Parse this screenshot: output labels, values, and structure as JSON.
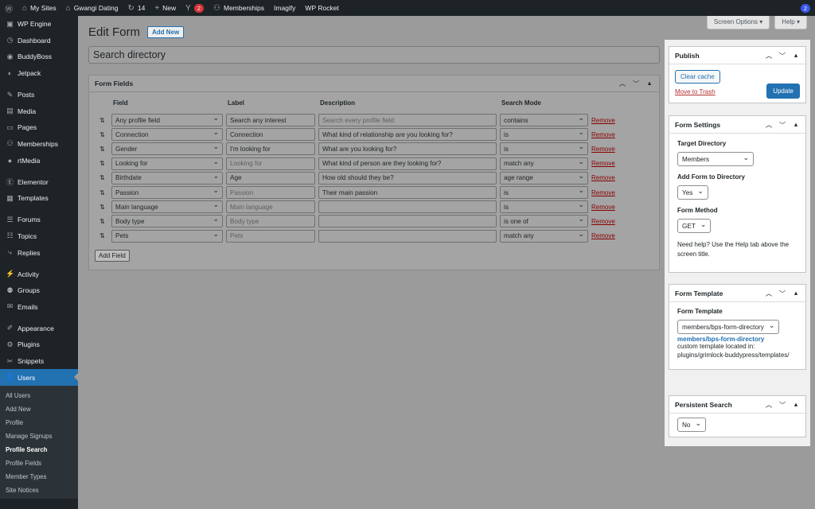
{
  "adminbar": {
    "my_sites": "My Sites",
    "site_name": "Gwangi Dating",
    "updates_count": "14",
    "new_label": "New",
    "yoast_badge": "2",
    "memberships": "Memberships",
    "imagify": "Imagify",
    "wp_rocket": "WP Rocket",
    "right_badge": "2"
  },
  "sidebar": {
    "items": [
      {
        "label": "WP Engine",
        "icon": "wp-engine-icon"
      },
      {
        "label": "Dashboard",
        "icon": "dashboard-icon"
      },
      {
        "label": "BuddyBoss",
        "icon": "buddyboss-icon"
      },
      {
        "label": "Jetpack",
        "icon": "jetpack-icon"
      },
      {
        "label": "Posts",
        "icon": "pin-icon"
      },
      {
        "label": "Media",
        "icon": "media-icon"
      },
      {
        "label": "Pages",
        "icon": "pages-icon"
      },
      {
        "label": "Memberships",
        "icon": "memberships-icon"
      },
      {
        "label": "rtMedia",
        "icon": "rtmedia-icon"
      },
      {
        "label": "Elementor",
        "icon": "elementor-icon"
      },
      {
        "label": "Templates",
        "icon": "templates-icon"
      },
      {
        "label": "Forums",
        "icon": "forums-icon"
      },
      {
        "label": "Topics",
        "icon": "topics-icon"
      },
      {
        "label": "Replies",
        "icon": "replies-icon"
      },
      {
        "label": "Activity",
        "icon": "activity-icon"
      },
      {
        "label": "Groups",
        "icon": "groups-icon"
      },
      {
        "label": "Emails",
        "icon": "emails-icon"
      },
      {
        "label": "Appearance",
        "icon": "appearance-icon"
      },
      {
        "label": "Plugins",
        "icon": "plugins-icon"
      },
      {
        "label": "Snippets",
        "icon": "snippets-icon"
      },
      {
        "label": "Users",
        "icon": "users-icon"
      }
    ],
    "submenu": [
      "All Users",
      "Add New",
      "Profile",
      "Manage Signups",
      "Profile Search",
      "Profile Fields",
      "Member Types",
      "Site Notices"
    ]
  },
  "screen_options": "Screen Options ▾",
  "help": "Help ▾",
  "page": {
    "title": "Edit Form",
    "add_new": "Add New",
    "form_title": "Search directory"
  },
  "form_fields": {
    "heading": "Form Fields",
    "headers": {
      "field": "Field",
      "label": "Label",
      "description": "Description",
      "mode": "Search Mode"
    },
    "remove": "Remove",
    "add_field": "Add Field",
    "rows": [
      {
        "field": "Any profile field",
        "label": "Search any interest",
        "label_ph": false,
        "desc": "Search every profile field",
        "desc_ph": true,
        "mode": "contains"
      },
      {
        "field": "Connection",
        "label": "Connection",
        "label_ph": false,
        "desc": "What kind of relationship are you looking for?",
        "desc_ph": false,
        "mode": "is"
      },
      {
        "field": "Gender",
        "label": "I'm looking for",
        "label_ph": false,
        "desc": "What are you looking for?",
        "desc_ph": false,
        "mode": "is"
      },
      {
        "field": "Looking for",
        "label": "Looking for",
        "label_ph": true,
        "desc": "What kind of person are they looking for?",
        "desc_ph": false,
        "mode": "match any"
      },
      {
        "field": "Birthdate",
        "label": "Age",
        "label_ph": false,
        "desc": "How old should they be?",
        "desc_ph": false,
        "mode": "age range"
      },
      {
        "field": "Passion",
        "label": "Passion",
        "label_ph": true,
        "desc": "Their main passion",
        "desc_ph": false,
        "mode": "is"
      },
      {
        "field": "Main language",
        "label": "Main language",
        "label_ph": true,
        "desc": "",
        "desc_ph": false,
        "mode": "is"
      },
      {
        "field": "Body type",
        "label": "Body type",
        "label_ph": true,
        "desc": "",
        "desc_ph": false,
        "mode": "is one of"
      },
      {
        "field": "Pets",
        "label": "Pets",
        "label_ph": true,
        "desc": "",
        "desc_ph": false,
        "mode": "match any"
      }
    ]
  },
  "publish": {
    "heading": "Publish",
    "clear_cache": "Clear cache",
    "trash": "Move to Trash",
    "update": "Update"
  },
  "settings": {
    "heading": "Form Settings",
    "target_label": "Target Directory",
    "target_value": "Members",
    "add_label": "Add Form to Directory",
    "add_value": "Yes",
    "method_label": "Form Method",
    "method_value": "GET",
    "help_text": "Need help? Use the Help tab above the screen title."
  },
  "template": {
    "heading": "Form Template",
    "label": "Form Template",
    "value": "members/bps-form-directory",
    "link": "members/bps-form-directory",
    "note1": "custom template located in:",
    "note2": "plugins/grimlock-buddypress/templates/"
  },
  "persistent": {
    "heading": "Persistent Search",
    "value": "No"
  },
  "colors": {
    "accent": "#2271b1",
    "danger": "#b32d2e",
    "admin_dark": "#1d2327"
  }
}
